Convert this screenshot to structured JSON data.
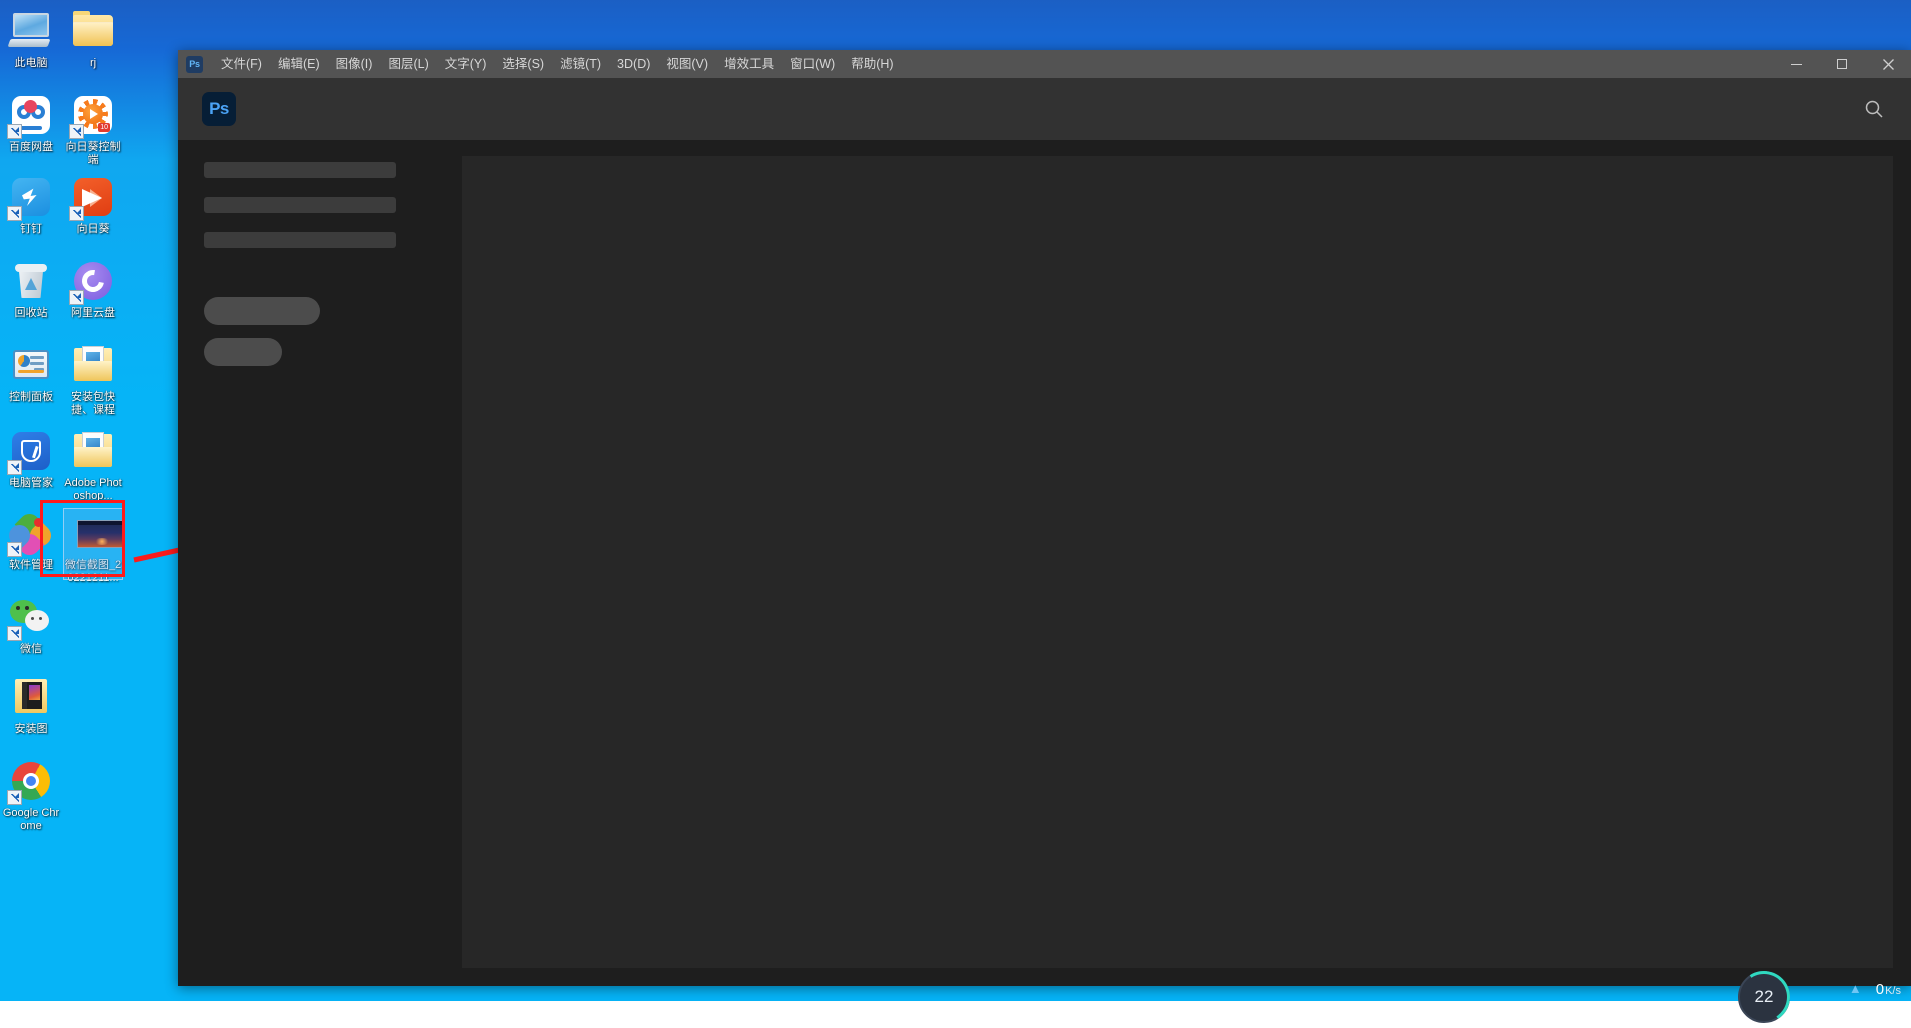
{
  "desktop": {
    "icons_col_a": [
      {
        "label": "此电脑",
        "icon": "this-pc-icon",
        "shortcut": false
      },
      {
        "label": "百度网盘",
        "icon": "baidu-netdisk-icon",
        "shortcut": true
      },
      {
        "label": "钉钉",
        "icon": "dingtalk-icon",
        "shortcut": true
      },
      {
        "label": "回收站",
        "icon": "recycle-bin-icon",
        "shortcut": false
      },
      {
        "label": "控制面板",
        "icon": "control-panel-icon",
        "shortcut": false
      },
      {
        "label": "电脑管家",
        "icon": "pc-manager-icon",
        "shortcut": true
      },
      {
        "label": "软件管理",
        "icon": "software-manager-icon",
        "shortcut": true
      },
      {
        "label": "微信",
        "icon": "wechat-icon",
        "shortcut": true
      },
      {
        "label": "安装图",
        "icon": "install-images-folder-icon",
        "shortcut": false
      },
      {
        "label": "Google Chrome",
        "icon": "chrome-icon",
        "shortcut": true
      }
    ],
    "icons_col_b": [
      {
        "label": "rj",
        "icon": "folder-icon",
        "shortcut": false
      },
      {
        "label": "向日葵控制端",
        "icon": "sunlogin-control-icon",
        "shortcut": true
      },
      {
        "label": "向日葵",
        "icon": "sunlogin-icon",
        "shortcut": true
      },
      {
        "label": "阿里云盘",
        "icon": "aliyun-drive-icon",
        "shortcut": true
      },
      {
        "label": "安装包快捷、课程",
        "icon": "doc-folder-icon",
        "shortcut": false
      },
      {
        "label": "Adobe Photoshop...",
        "icon": "doc-folder-icon",
        "shortcut": false
      },
      {
        "label": "微信截图_20221211...",
        "icon": "screenshot-thumbnail-icon",
        "shortcut": false,
        "selected": true
      }
    ]
  },
  "annotation": {
    "highlight_color": "#ff1a1a",
    "arrow_from": "微信截图_20221211...",
    "arrow_to": "photoshop-canvas"
  },
  "ps_window": {
    "logo_text": "Ps",
    "titlebar_logo": "Ps",
    "menus": [
      {
        "label": "文件(F)",
        "name": "menu-file"
      },
      {
        "label": "编辑(E)",
        "name": "menu-edit"
      },
      {
        "label": "图像(I)",
        "name": "menu-image"
      },
      {
        "label": "图层(L)",
        "name": "menu-layer"
      },
      {
        "label": "文字(Y)",
        "name": "menu-type"
      },
      {
        "label": "选择(S)",
        "name": "menu-select"
      },
      {
        "label": "滤镜(T)",
        "name": "menu-filter"
      },
      {
        "label": "3D(D)",
        "name": "menu-3d"
      },
      {
        "label": "视图(V)",
        "name": "menu-view"
      },
      {
        "label": "增效工具",
        "name": "menu-plugins"
      },
      {
        "label": "窗口(W)",
        "name": "menu-window"
      },
      {
        "label": "帮助(H)",
        "name": "menu-help"
      }
    ],
    "window_controls": {
      "minimize": "minimize-button",
      "maximize": "maximize-button",
      "close": "close-button"
    },
    "search_icon": "search-icon",
    "sidebar_skeleton": {
      "bars": 3,
      "pills": 2
    }
  },
  "taskbar": {
    "network_gauge_value": "22",
    "network_speed_value": "0",
    "network_speed_unit": "K/s",
    "upload_arrow": "upload-arrow-icon"
  }
}
